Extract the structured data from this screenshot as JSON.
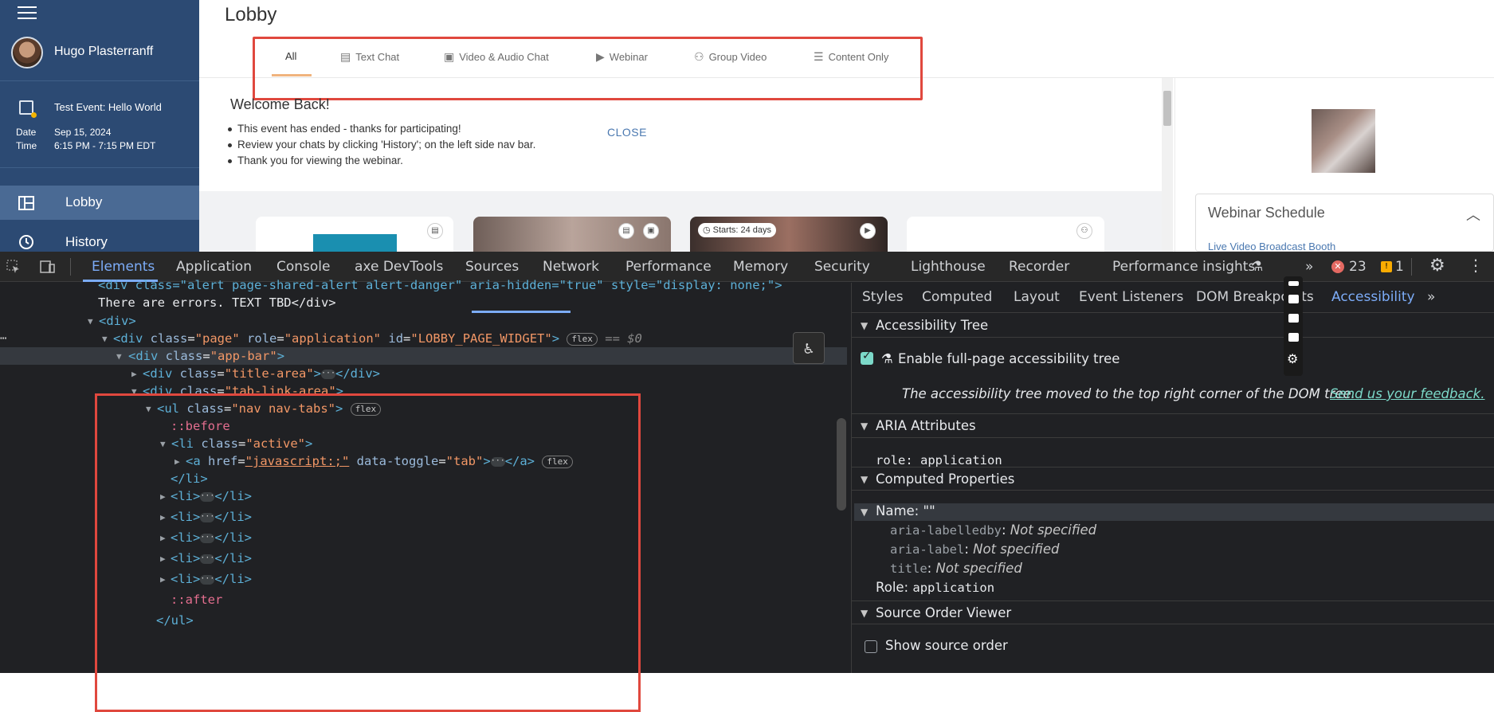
{
  "app": {
    "user_name": "Hugo Plasterranff",
    "event_title": "Test Event: Hello World",
    "date_label": "Date",
    "date_value": "Sep 15, 2024",
    "time_label": "Time",
    "time_value": "6:15 PM - 7:15 PM EDT",
    "nav": [
      {
        "label": "Lobby",
        "icon": "grid-icon",
        "active": true
      },
      {
        "label": "History",
        "icon": "history-icon",
        "active": false
      }
    ],
    "page_title": "Lobby",
    "tabs": [
      {
        "label": "All",
        "icon": "",
        "active": true
      },
      {
        "label": "Text Chat",
        "icon": "chat-icon"
      },
      {
        "label": "Video & Audio Chat",
        "icon": "video-chat-icon"
      },
      {
        "label": "Webinar",
        "icon": "play-icon"
      },
      {
        "label": "Group Video",
        "icon": "group-icon"
      },
      {
        "label": "Content Only",
        "icon": "document-icon"
      }
    ],
    "welcome_title": "Welcome Back!",
    "bullets": [
      "This event has ended - thanks for participating!",
      "Review your chats by clicking 'History'; on the left side nav bar.",
      "Thank you for viewing the webinar."
    ],
    "close_label": "CLOSE",
    "card_badge": "Starts: 24 days",
    "schedule_title": "Webinar Schedule",
    "schedule_link": "Live Video Broadcast Booth"
  },
  "devtools": {
    "tabs": [
      "Elements",
      "Application",
      "Console",
      "axe DevTools",
      "Sources",
      "Network",
      "Performance",
      "Memory",
      "Security",
      "Lighthouse",
      "Recorder",
      "Performance insights"
    ],
    "selected_tab": "Elements",
    "error_count": "23",
    "warning_count": "1",
    "tree_lines": {
      "l0": "<div class=\"alert page-shared-alert alert-danger\" aria-hidden=\"true\" style=\"display: none;\">",
      "l1": "There are errors. TEXT TBD</div>",
      "l2": "<div>",
      "l3_tag": "<div",
      "l3_attr1": "class",
      "l3_val1": "\"page\"",
      "l3_attr2": "role",
      "l3_val2": "\"application\"",
      "l3_attr3": "id",
      "l3_val3": "\"LOBBY_PAGE_WIDGET\"",
      "l3_end": ">",
      "dollar0": "== $0",
      "l4": "\"app-bar\"",
      "l5": "\"title-area\"",
      "l6": "\"tab-link-area\"",
      "l7": "\"nav nav-tabs\"",
      "before": "::before",
      "l9": "\"active\"",
      "l10_href": "\"javascript:;\"",
      "l10_toggle": "\"tab\"",
      "after": "::after",
      "flex": "flex"
    },
    "sub_tabs": [
      "Styles",
      "Computed",
      "Layout",
      "Event Listeners",
      "DOM Breakpoints",
      "Accessibility"
    ],
    "selected_sub_tab": "Accessibility",
    "a11y": {
      "tree_title": "Accessibility Tree",
      "enable_label": "Enable full-page accessibility tree",
      "moved_note": "The accessibility tree moved to the top right corner of the DOM tree.",
      "feedback_link": "Send us your feedback.",
      "aria_title": "ARIA Attributes",
      "role_key": "role",
      "role_value": "application",
      "computed_title": "Computed Properties",
      "name_row": "Name: \"\"",
      "labelledby_key": "aria-labelledby",
      "label_key": "aria-label",
      "title_key": "title",
      "not_specified": "Not specified",
      "role_label": "Role:",
      "sov_title": "Source Order Viewer",
      "show_source_order": "Show source order"
    }
  }
}
